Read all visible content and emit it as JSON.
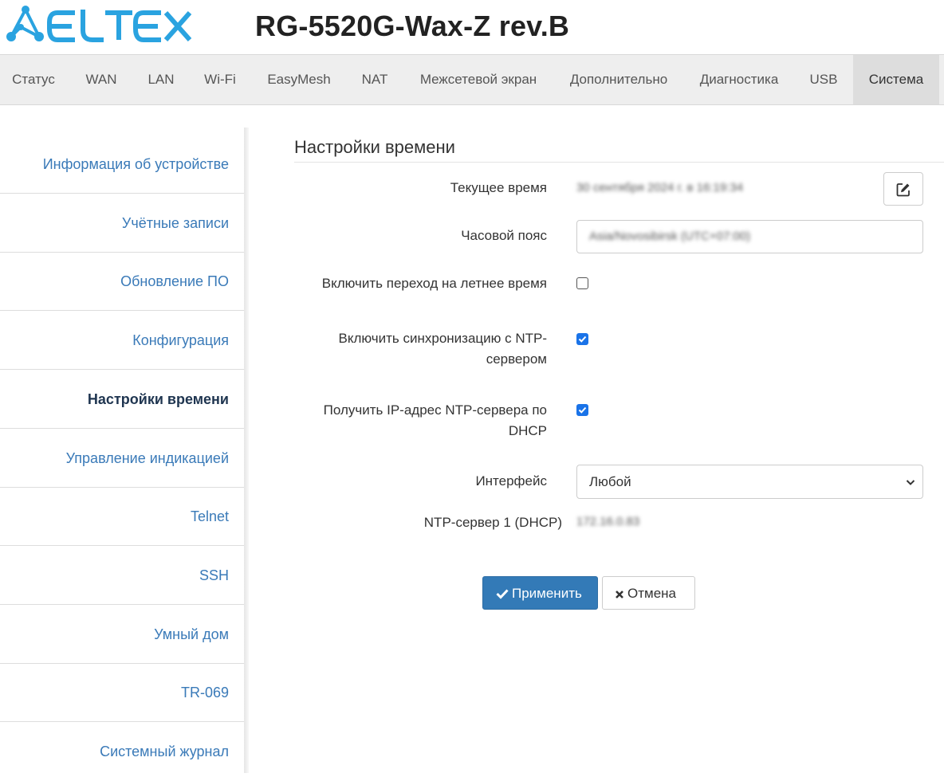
{
  "header": {
    "logo_text": "ELTEX",
    "model": "RG-5520G-Wax-Z rev.B"
  },
  "nav": {
    "tabs": [
      {
        "label": "Статус"
      },
      {
        "label": "WAN"
      },
      {
        "label": "LAN"
      },
      {
        "label": "Wi-Fi"
      },
      {
        "label": "EasyMesh"
      },
      {
        "label": "NAT"
      },
      {
        "label": "Межсетевой экран"
      },
      {
        "label": "Дополнительно"
      },
      {
        "label": "Диагностика"
      },
      {
        "label": "USB"
      },
      {
        "label": "Система"
      }
    ],
    "active_tab": "Система"
  },
  "sidebar": {
    "items": [
      {
        "label": "Информация об устройстве"
      },
      {
        "label": "Учётные записи"
      },
      {
        "label": "Обновление ПО"
      },
      {
        "label": "Конфигурация"
      },
      {
        "label": "Настройки времени"
      },
      {
        "label": "Управление индикацией"
      },
      {
        "label": "Telnet"
      },
      {
        "label": "SSH"
      },
      {
        "label": "Умный дом"
      },
      {
        "label": "TR-069"
      },
      {
        "label": "Системный журнал"
      }
    ],
    "active_item": "Настройки времени"
  },
  "form": {
    "title": "Настройки времени",
    "current_time_label": "Текущее время",
    "current_time_value": "30 сентября 2024 г. в 16:19:34",
    "timezone_label": "Часовой пояс",
    "timezone_value": "Asia/Novosibirsk (UTC+07:00)",
    "dst_label": "Включить переход на летнее время",
    "dst_checked": false,
    "ntp_sync_label": "Включить синхронизацию с NTP-сервером",
    "ntp_sync_checked": true,
    "ntp_dhcp_label": "Получить IP-адрес NTP-сервера по DHCP",
    "ntp_dhcp_checked": true,
    "interface_label": "Интерфейс",
    "interface_value": "Любой",
    "ntp_server_label": "NTP-сервер 1 (DHCP)",
    "ntp_server_value": "172.16.0.83",
    "apply_label": "Применить",
    "cancel_label": "Отмена"
  },
  "colors": {
    "link": "#3a7ab8",
    "active_sidebar": "#1f3550",
    "primary_button": "#337ab7",
    "logo": "#2aa3e0",
    "checkbox": "#1a73e8"
  }
}
